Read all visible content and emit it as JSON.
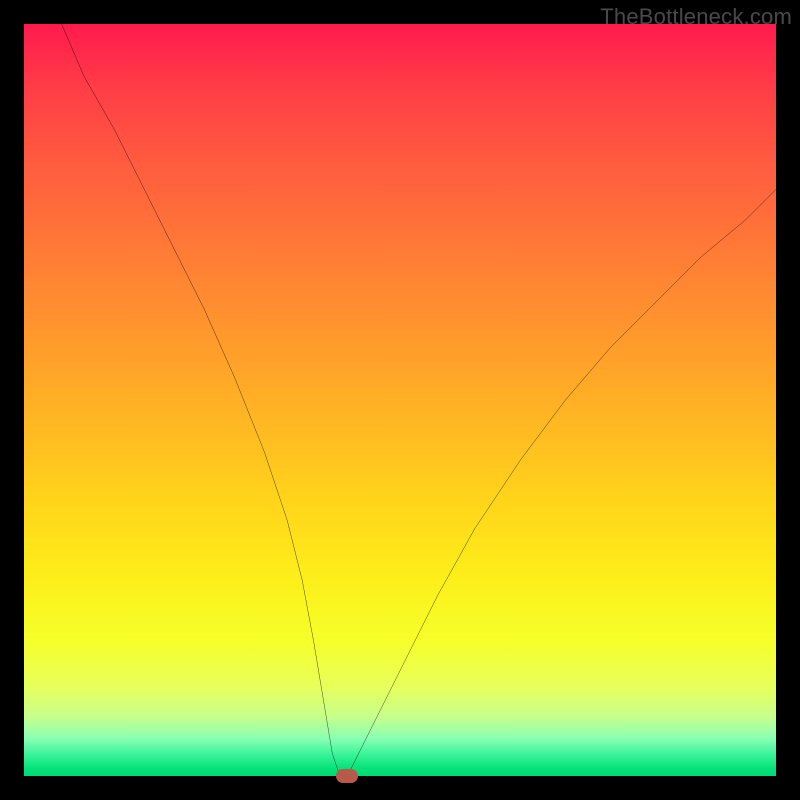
{
  "watermark": "TheBottleneck.com",
  "chart_data": {
    "type": "line",
    "title": "",
    "xlabel": "",
    "ylabel": "",
    "xlim": [
      0,
      100
    ],
    "ylim": [
      0,
      100
    ],
    "series": [
      {
        "name": "curve",
        "x": [
          5,
          8,
          12,
          16,
          20,
          24,
          28,
          32,
          35,
          37,
          38.5,
          40,
          41,
          42,
          43,
          44,
          46,
          50,
          55,
          60,
          66,
          72,
          78,
          84,
          90,
          96,
          100
        ],
        "y": [
          100,
          93,
          86,
          78,
          70,
          62,
          53,
          43,
          34,
          26,
          18,
          9,
          3,
          0,
          0,
          2,
          6,
          14,
          24,
          33,
          42,
          50,
          57,
          63,
          69,
          74,
          78
        ]
      }
    ],
    "marker": {
      "x": 43,
      "y": 0
    },
    "background_gradient": [
      "#ff1a4d",
      "#ff9a2c",
      "#fdef1a",
      "#02d873"
    ]
  }
}
